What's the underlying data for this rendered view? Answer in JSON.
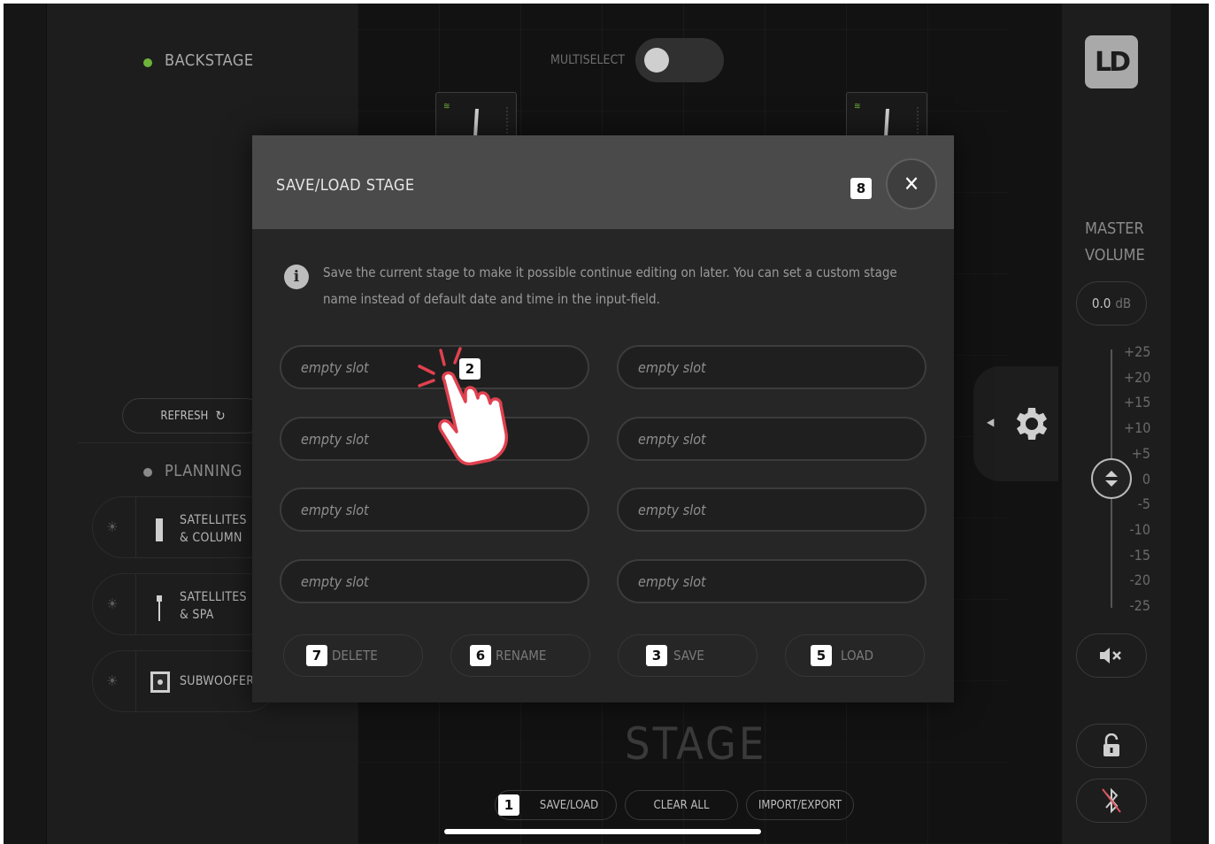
{
  "left_panel": {
    "backstage_label": "BACKSTAGE",
    "refresh_label": "REFRESH",
    "planning_label": "PLANNING",
    "devices": [
      {
        "name_line1": "SATELLITES",
        "name_line2": "& COLUMN"
      },
      {
        "name_line1": "SATELLITES",
        "name_line2": "& SPA"
      },
      {
        "name_line1": "SUBWOOFER",
        "name_line2": ""
      }
    ]
  },
  "stage": {
    "multiselect_label": "MULTISELECT",
    "multiselect_on": false,
    "title": "STAGE",
    "bottom_buttons": {
      "save_load": "SAVE/LOAD",
      "clear_all": "CLEAR ALL",
      "import_export": "IMPORT/EXPORT"
    }
  },
  "dialog": {
    "title": "SAVE/LOAD STAGE",
    "close_icon": "close-icon",
    "info_text": "Save the current stage to make it possible continue editing on later. You can set a custom stage name instead of default date and time in the input-field.",
    "slots": [
      "empty slot",
      "empty slot",
      "empty slot",
      "empty slot",
      "empty slot",
      "empty slot",
      "empty slot",
      "empty slot"
    ],
    "actions": {
      "delete": "DELETE",
      "rename": "RENAME",
      "save": "SAVE",
      "load": "LOAD"
    }
  },
  "badges": {
    "save_load": "1",
    "slot_tap": "2",
    "save": "3",
    "load": "5",
    "rename": "6",
    "delete": "7",
    "close": "8"
  },
  "right_panel": {
    "logo": "LD",
    "master_line1": "MASTER",
    "master_line2": "VOLUME",
    "volume_value": "0.0",
    "volume_unit": "dB",
    "scale": [
      "+25",
      "+20",
      "+15",
      "+10",
      "+5",
      "0",
      "-5",
      "-10",
      "-15",
      "-20",
      "-25"
    ]
  },
  "colors": {
    "online_dot": "#6fb33a",
    "offline_dot": "#8a8a8a",
    "hand_outline": "#e0414f"
  }
}
